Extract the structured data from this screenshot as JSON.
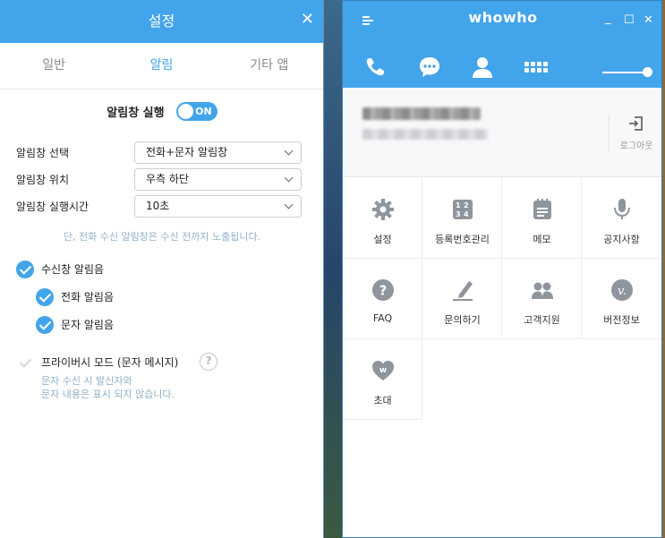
{
  "settings": {
    "title": "설정",
    "close": "✕",
    "tabs": [
      "일반",
      "알림",
      "기타 앱"
    ],
    "active_tab": "알림",
    "run": {
      "label": "알림창 실행",
      "toggle_text": "ON"
    },
    "fields": [
      {
        "label": "알림창 선택",
        "value": "전화+문자 알림창"
      },
      {
        "label": "알림창 위치",
        "value": "우측 하단"
      },
      {
        "label": "알림창 실행시간",
        "value": "10초"
      }
    ],
    "hint": "단, 전화 수신 알림창은 수신 전까지 노출됩니다.",
    "checks": {
      "ring": "수신창 알림음",
      "call": "전화 알림음",
      "sms": "문자 알림음",
      "privacy": "프라이버시 모드 (문자 메시지)",
      "privacy_help": "?"
    },
    "privacy_note_1": "문자 수신 시 발신자와",
    "privacy_note_2": "문자 내용은 표시 되지 않습니다."
  },
  "whowho": {
    "logo": "whowho",
    "win": {
      "minimize": "_",
      "maximize": "☐",
      "close": "✕"
    },
    "logout_label": "로그아웃",
    "menu": [
      "설정",
      "등록번호관리",
      "메모",
      "공지사항",
      "FAQ",
      "문의하기",
      "고객지원",
      "버전정보",
      "초대"
    ]
  },
  "colors": {
    "accent": "#42a4ea",
    "icon_gray": "#8e959d"
  }
}
